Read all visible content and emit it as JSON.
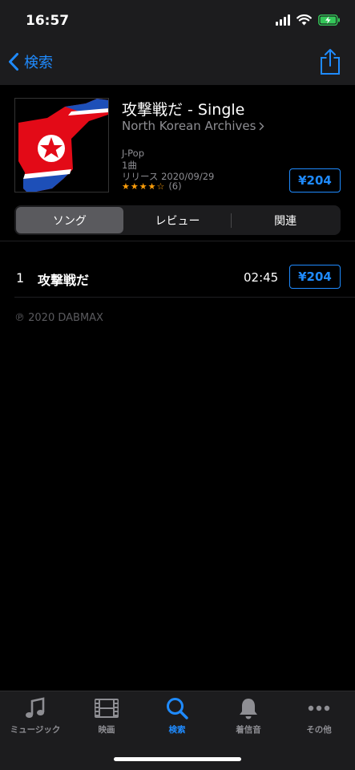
{
  "status_bar": {
    "time": "16:57"
  },
  "nav": {
    "back_label": "検索",
    "share_icon": "share-icon"
  },
  "album": {
    "title": "攻撃戦だ - Single",
    "artist": "North Korean Archives",
    "genre": "J-Pop",
    "track_count": "1曲",
    "release": "リリース 2020/09/29",
    "stars": "★★★★☆",
    "rating_count": "(6)",
    "rating_value": 4.5,
    "price": "¥204"
  },
  "segments": {
    "items": [
      "ソング",
      "レビュー",
      "関連"
    ],
    "active": "ソング"
  },
  "tracks": [
    {
      "number": "1",
      "title": "攻撃戦だ",
      "duration": "02:45",
      "price": "¥204"
    }
  ],
  "copyright": "℗ 2020 DABMAX",
  "tab_bar": {
    "items": [
      {
        "label": "ミュージック",
        "icon": "music-note-icon"
      },
      {
        "label": "映画",
        "icon": "film-icon"
      },
      {
        "label": "検索",
        "icon": "search-icon"
      },
      {
        "label": "着信音",
        "icon": "bell-icon"
      },
      {
        "label": "その他",
        "icon": "more-icon"
      }
    ],
    "active": "検索"
  },
  "colors": {
    "accent": "#1f8bff",
    "star": "#ff9f0a",
    "background": "#000000",
    "bar": "#1c1c1e"
  }
}
